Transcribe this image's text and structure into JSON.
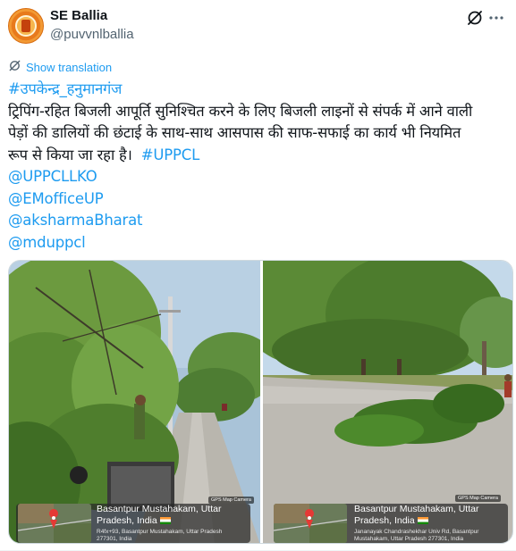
{
  "author": {
    "name": "SE Ballia",
    "handle": "@puvvnlballia"
  },
  "translate_label": "Show translation",
  "tweet": {
    "hashtag_line": "#उपकेन्द्र_हनुमानगंज",
    "text_line1": "ट्रिपिंग-रहित बिजली आपूर्ति सुनिश्चित करने के लिए बिजली लाइनों से संपर्क में आने वाली",
    "text_line2": "पेड़ों की डालियों की छंटाई के साथ-साथ आसपास की साफ-सफाई का कार्य भी नियमित",
    "text_line3": "रूप से किया जा रहा है।",
    "hashtag_uppcl": "#UPPCL",
    "mentions": [
      "@UPPCLLKO",
      "@EMofficeUP",
      "@aksharmaBharat",
      "@mduppcl"
    ]
  },
  "media": {
    "left": {
      "badge": "GPS Map Camera",
      "place": "Basantpur Mustahakam, Uttar Pradesh, India",
      "address": "R4fx+93, Basantpur Mustahakam, Uttar Pradesh",
      "address2": "277301, India"
    },
    "right": {
      "badge": "GPS Map Camera",
      "place": "Basantpur Mustahakam, Uttar Pradesh, India",
      "address": "Jananayak Chandrashekhar Univ Rd, Basantpur",
      "address2": "Mustahakam, Uttar Pradesh 277301, India"
    }
  },
  "colors": {
    "link": "#1d9bf0",
    "text": "#0f1419",
    "secondary": "#536471"
  },
  "icons": {
    "avatar": "avatar-logo",
    "grok": "grok-icon",
    "more": "more-icon",
    "translate": "translate-icon",
    "map_pin": "map-pin-icon"
  }
}
